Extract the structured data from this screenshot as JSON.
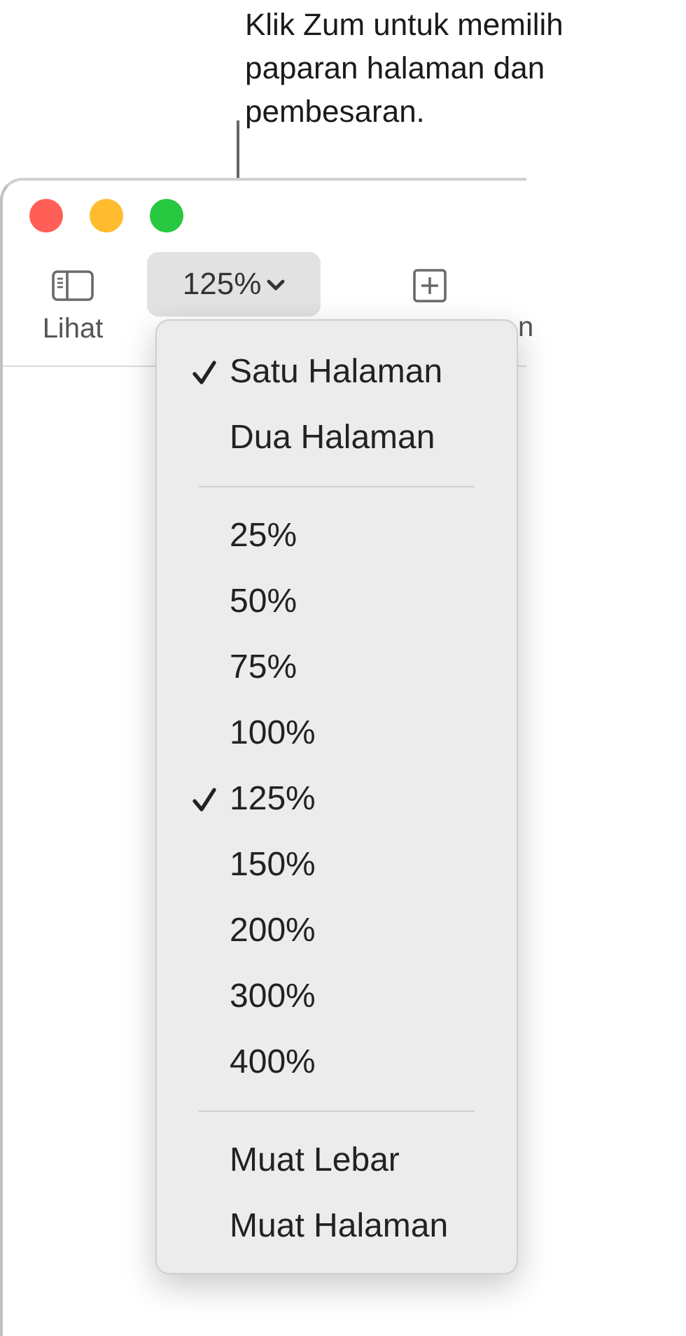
{
  "callout": "Klik Zum untuk memilih paparan halaman dan pembesaran.",
  "window": {
    "toolbar": [
      {
        "kind": "sidebar",
        "label": "Lihat"
      },
      {
        "kind": "zoom",
        "value": "125%"
      },
      {
        "kind": "insert",
        "label": "n"
      }
    ]
  },
  "zoom_menu": {
    "items": [
      {
        "kind": "item",
        "label": "Satu Halaman",
        "checked": true
      },
      {
        "kind": "item",
        "label": "Dua Halaman",
        "checked": false
      },
      {
        "kind": "separator"
      },
      {
        "kind": "item",
        "label": "25%",
        "checked": false
      },
      {
        "kind": "item",
        "label": "50%",
        "checked": false
      },
      {
        "kind": "item",
        "label": "75%",
        "checked": false
      },
      {
        "kind": "item",
        "label": "100%",
        "checked": false
      },
      {
        "kind": "item",
        "label": "125%",
        "checked": true
      },
      {
        "kind": "item",
        "label": "150%",
        "checked": false
      },
      {
        "kind": "item",
        "label": "200%",
        "checked": false
      },
      {
        "kind": "item",
        "label": "300%",
        "checked": false
      },
      {
        "kind": "item",
        "label": "400%",
        "checked": false
      },
      {
        "kind": "separator"
      },
      {
        "kind": "item",
        "label": "Muat Lebar",
        "checked": false
      },
      {
        "kind": "item",
        "label": "Muat Halaman",
        "checked": false
      }
    ]
  }
}
